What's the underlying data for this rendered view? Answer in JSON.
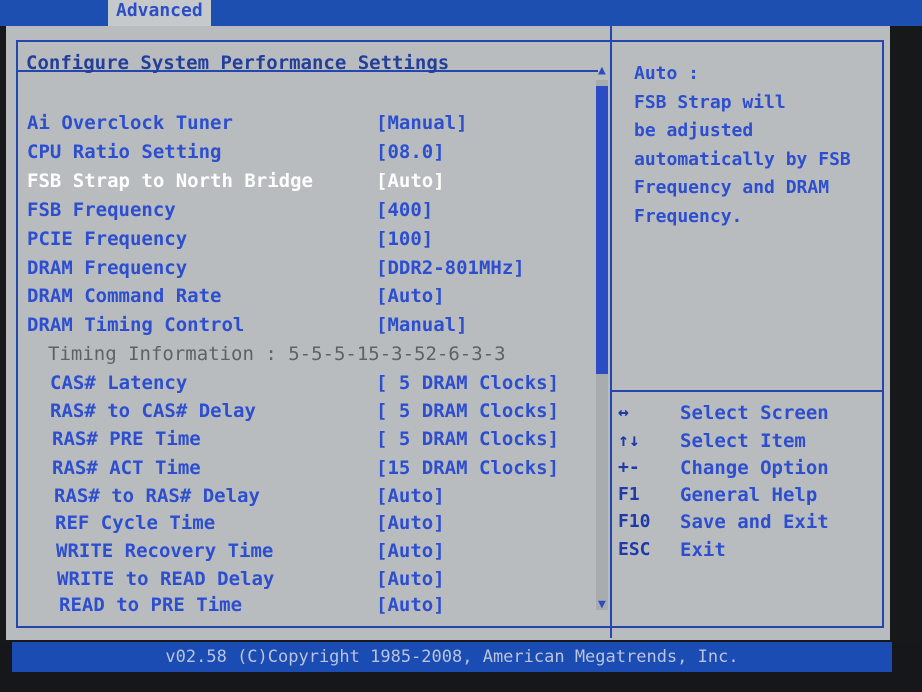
{
  "tabs": {
    "active": "Advanced"
  },
  "page": {
    "title": "Configure System Performance Settings"
  },
  "settings": [
    {
      "label": "Ai Overclock Tuner",
      "value": "[Manual]"
    },
    {
      "label": "CPU Ratio Setting",
      "value": "[08.0]"
    },
    {
      "label": "FSB Strap to North Bridge",
      "value": "[Auto]",
      "selected": true
    },
    {
      "label": "FSB Frequency",
      "value": "[400]"
    },
    {
      "label": "PCIE Frequency",
      "value": "[100]"
    },
    {
      "label": "DRAM Frequency",
      "value": "[DDR2-801MHz]"
    },
    {
      "label": "DRAM Command Rate",
      "value": "[Auto]"
    },
    {
      "label": "DRAM Timing Control",
      "value": "[Manual]"
    },
    {
      "label": "Timing Information : 5-5-5-15-3-52-6-3-3",
      "value": "",
      "info": true
    },
    {
      "label": "CAS# Latency",
      "value": "[ 5 DRAM Clocks]",
      "sub": true
    },
    {
      "label": "RAS# to CAS# Delay",
      "value": "[ 5 DRAM Clocks]",
      "sub": true
    },
    {
      "label": "RAS# PRE Time",
      "value": "[ 5 DRAM Clocks]",
      "sub": true
    },
    {
      "label": "RAS# ACT Time",
      "value": "[15 DRAM Clocks]",
      "sub": true
    },
    {
      "label": "RAS# to RAS# Delay",
      "value": "[Auto]",
      "sub": true
    },
    {
      "label": "REF Cycle Time",
      "value": "[Auto]",
      "sub": true
    },
    {
      "label": "WRITE Recovery Time",
      "value": "[Auto]",
      "sub": true
    },
    {
      "label": "WRITE to READ Delay",
      "value": "[Auto]",
      "sub": true
    },
    {
      "label": "READ to PRE Time",
      "value": "[Auto]",
      "sub": true
    }
  ],
  "help": {
    "lines": [
      "Auto :",
      "FSB Strap will",
      "be adjusted",
      "automatically by FSB",
      "Frequency and DRAM",
      "Frequency."
    ]
  },
  "keys": [
    {
      "key": "↔",
      "desc": "Select Screen",
      "icon": "left-right-arrow-icon"
    },
    {
      "key": "↑↓",
      "desc": "Select Item",
      "icon": "up-down-arrow-icon"
    },
    {
      "key": "+-",
      "desc": "Change Option",
      "icon": "plus-minus-icon"
    },
    {
      "key": "F1",
      "desc": "General Help"
    },
    {
      "key": "F10",
      "desc": "Save and Exit"
    },
    {
      "key": "ESC",
      "desc": "Exit"
    }
  ],
  "scrollbar": {
    "up_icon": "▲",
    "down_icon": "▼"
  },
  "footer": {
    "text": "v02.58 (C)Copyright 1985-2008, American Megatrends, Inc."
  },
  "colors": {
    "accent_blue": "#2d4fcf",
    "menu_bar": "#1d4fb0",
    "panel_grey": "#b9bcbe",
    "selected_text": "#ffffff"
  }
}
